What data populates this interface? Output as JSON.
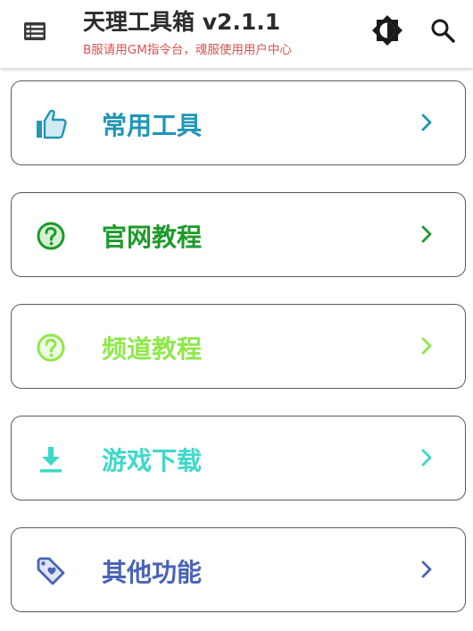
{
  "header": {
    "title": "天理工具箱 v2.1.1",
    "subtitle": "B服请用GM指令台，魂服使用用户中心",
    "menu_icon": "list-menu-icon",
    "theme_icon": "brightness-icon",
    "search_icon": "search-icon"
  },
  "colors": {
    "header_title": "#2c2c2c",
    "subtitle": "#d9534f",
    "card_border": "#5a5a5a"
  },
  "menu": [
    {
      "label": "常用工具",
      "icon": "thumb-up-icon",
      "color": "#2196b6"
    },
    {
      "label": "官网教程",
      "icon": "help-circle-icon",
      "color": "#1e9a2a"
    },
    {
      "label": "频道教程",
      "icon": "help-circle-icon",
      "color": "#8ee84a"
    },
    {
      "label": "游戏下载",
      "icon": "download-icon",
      "color": "#3fd8c8"
    },
    {
      "label": "其他功能",
      "icon": "tag-heart-icon",
      "color": "#4a63b8"
    }
  ]
}
